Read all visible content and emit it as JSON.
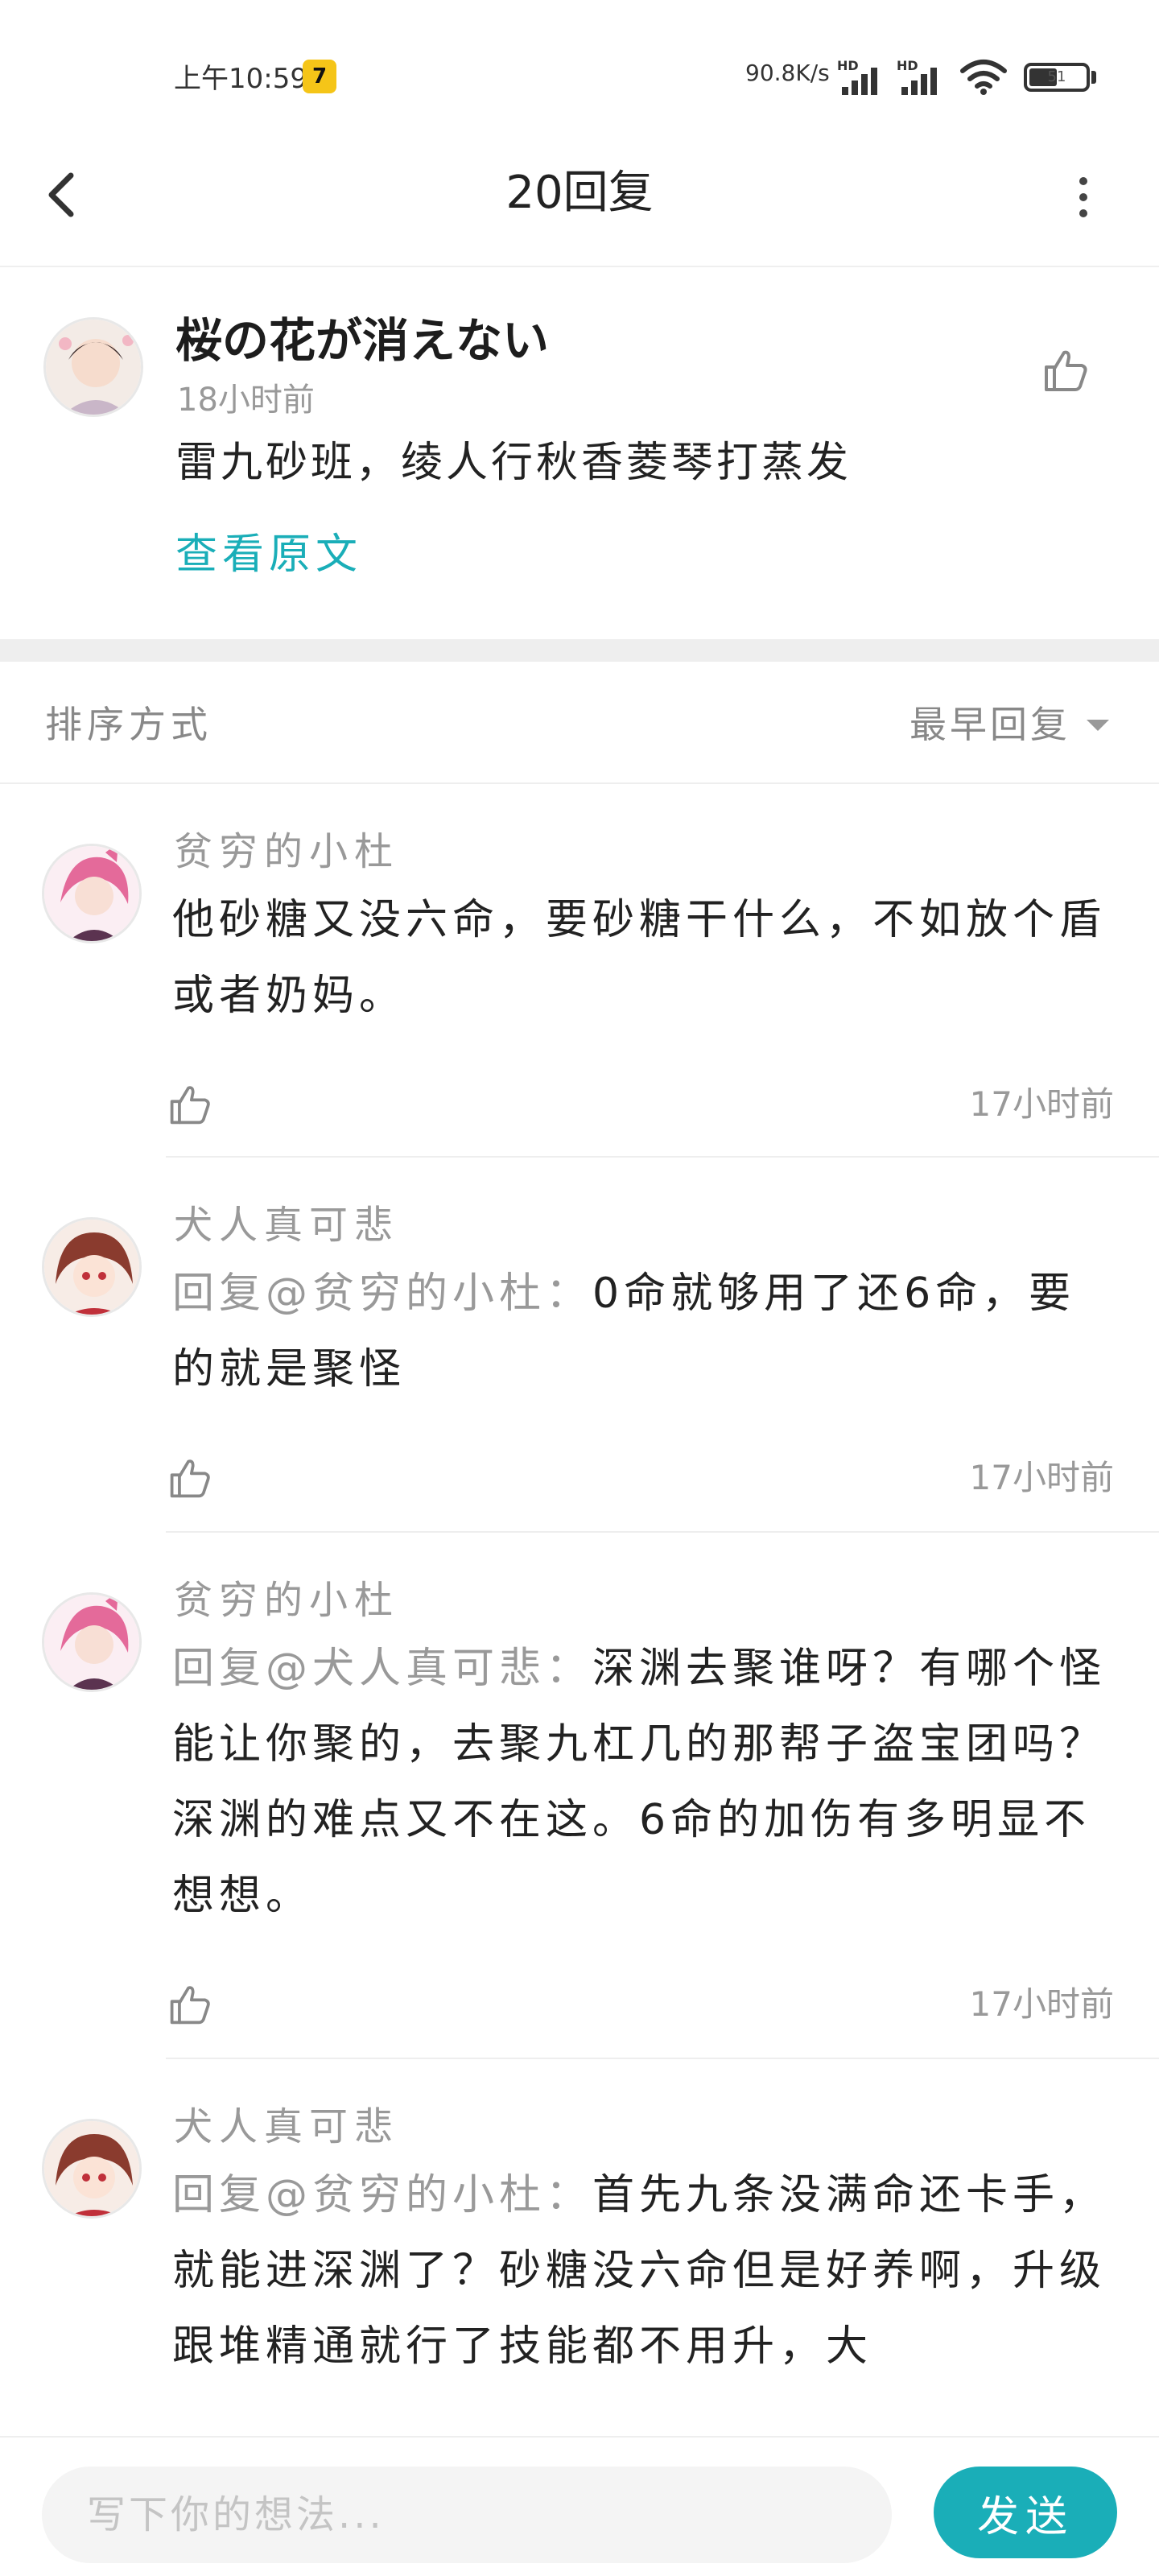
{
  "status_bar": {
    "time": "上午10:59",
    "app_badge": "7",
    "net_speed": "90.8K/s",
    "signal1_label": "HD",
    "signal2_label": "HD",
    "battery_level": "51"
  },
  "app_bar": {
    "title": "20回复",
    "back_icon": "chevron-left-icon",
    "more_icon": "more-vertical-icon"
  },
  "original": {
    "author": "桜の花が消えない",
    "time": "18小时前",
    "text": "雷九砂班，绫人行秋香菱琴打蒸发",
    "view_original": "查看原文",
    "like_icon": "thumbs-up-icon"
  },
  "sort": {
    "label": "排序方式",
    "selected": "最早回复"
  },
  "replies": [
    {
      "author": "贫穷的小杜",
      "mention": "",
      "text": "他砂糖又没六命，要砂糖干什么，不如放个盾或者奶妈。",
      "time": "17小时前",
      "avatar_color": "#e46a9a"
    },
    {
      "author": "犬人真可悲",
      "mention": "回复@贫穷的小杜：",
      "text": "0命就够用了还6命，要的就是聚怪",
      "time": "17小时前",
      "avatar_color": "#8a3b2e"
    },
    {
      "author": "贫穷的小杜",
      "mention": "回复@犬人真可悲：",
      "text": "深渊去聚谁呀？有哪个怪能让你聚的，去聚九杠几的那帮子盗宝团吗？深渊的难点又不在这。6命的加伤有多明显不想想。",
      "time": "17小时前",
      "avatar_color": "#e46a9a"
    },
    {
      "author": "犬人真可悲",
      "mention": "回复@贫穷的小杜：",
      "text": "首先九条没满命还卡手，就能进深渊了？砂糖没六命但是好养啊，升级跟堆精通就行了技能都不用升，大",
      "time": "",
      "avatar_color": "#8a3b2e"
    }
  ],
  "composer": {
    "placeholder": "写下你的想法...",
    "send_label": "发送"
  },
  "colors": {
    "accent": "#1aaeb8",
    "muted": "#999999"
  }
}
